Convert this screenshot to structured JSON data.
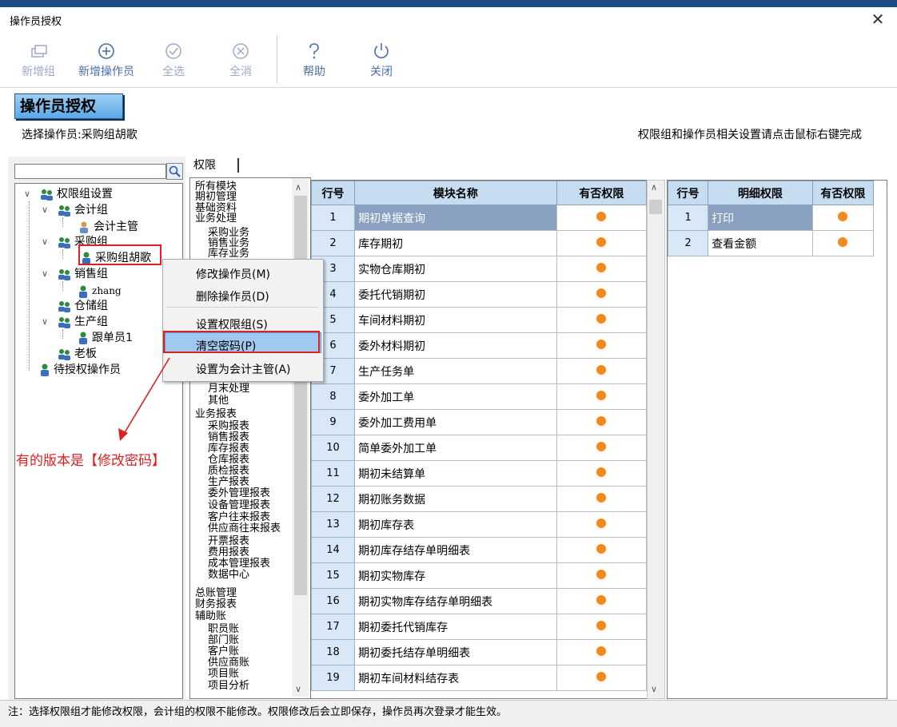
{
  "window": {
    "title": "操作员授权",
    "close": "✕"
  },
  "toolbar": {
    "new_group": "新增组",
    "new_operator": "新增操作员",
    "select_all": "全选",
    "deselect_all": "全消",
    "help": "帮助",
    "close": "关闭"
  },
  "header": {
    "title": "操作员授权",
    "selected_operator": "选择操作员:采购组胡歌",
    "hint": "权限组和操作员相关设置请点击鼠标右键完成"
  },
  "tree": {
    "root": "权限组设置",
    "accounting": "会计组",
    "accounting_supervisor": "会计主管",
    "purchase": "采购组",
    "purchase_user": "采购组胡歌",
    "sales": "销售组",
    "sales_user": "zhang",
    "warehouse": "仓储组",
    "production": "生产组",
    "production_user": "跟单员1",
    "boss": "老板",
    "pending": "待授权操作员"
  },
  "tab": {
    "label": "权限"
  },
  "modules": [
    "所有模块",
    "期初管理",
    "基础资料",
    "业务处理",
    "采购业务",
    "销售业务",
    "库存业务",
    "月末处理",
    "其他",
    "业务报表",
    "采购报表",
    "销售报表",
    "库存报表",
    "仓库报表",
    "质检报表",
    "生产报表",
    "委外管理报表",
    "设备管理报表",
    "客户往来报表",
    "供应商往来报表",
    "开票报表",
    "费用报表",
    "成本管理报表",
    "数据中心",
    "总账管理",
    "财务报表",
    "辅助账",
    "职员账",
    "部门账",
    "客户账",
    "供应商账",
    "项目账",
    "项目分析"
  ],
  "grid": {
    "headers": {
      "row": "行号",
      "name": "模块名称",
      "perm": "有否权限"
    },
    "rows": [
      {
        "n": "1",
        "name": "期初单据查询"
      },
      {
        "n": "2",
        "name": "库存期初"
      },
      {
        "n": "3",
        "name": "实物仓库期初"
      },
      {
        "n": "4",
        "name": "委托代销期初"
      },
      {
        "n": "5",
        "name": "车间材料期初"
      },
      {
        "n": "6",
        "name": "委外材料期初"
      },
      {
        "n": "7",
        "name": "生产任务单"
      },
      {
        "n": "8",
        "name": "委外加工单"
      },
      {
        "n": "9",
        "name": "委外加工费用单"
      },
      {
        "n": "10",
        "name": "简单委外加工单"
      },
      {
        "n": "11",
        "name": "期初未结算单"
      },
      {
        "n": "12",
        "name": "期初账务数据"
      },
      {
        "n": "13",
        "name": "期初库存表"
      },
      {
        "n": "14",
        "name": "期初库存结存单明细表"
      },
      {
        "n": "15",
        "name": "期初实物库存"
      },
      {
        "n": "16",
        "name": "期初实物库存结存单明细表"
      },
      {
        "n": "17",
        "name": "期初委托代销库存"
      },
      {
        "n": "18",
        "name": "期初委托结存单明细表"
      },
      {
        "n": "19",
        "name": "期初车间材料结存表"
      }
    ]
  },
  "detail": {
    "headers": {
      "row": "行号",
      "name": "明细权限",
      "perm": "有否权限"
    },
    "rows": [
      {
        "n": "1",
        "name": "打印"
      },
      {
        "n": "2",
        "name": "查看金额"
      }
    ]
  },
  "context_menu": {
    "modify": "修改操作员(M)",
    "delete": "删除操作员(D)",
    "set_group": "设置权限组(S)",
    "clear_password": "清空密码(P)",
    "set_supervisor": "设置为会计主管(A)"
  },
  "annotation": "有的版本是【修改密码】",
  "status": "注：选择权限组才能修改权限，会计组的权限不能修改。权限修改后会立即保存，操作员再次登录才能生效。",
  "colors": {
    "accent": "#5aa8e6",
    "permission_dot": "#f08a1c",
    "highlight": "#e02020"
  }
}
